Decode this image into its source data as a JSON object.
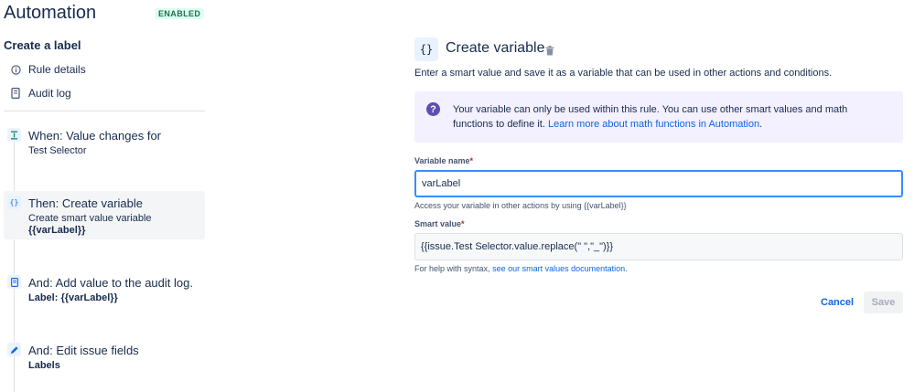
{
  "header": {
    "title": "Automation",
    "badge": "ENABLED"
  },
  "rule": {
    "name": "Create a label"
  },
  "menu": [
    {
      "label": "Rule details",
      "icon": "info-icon"
    },
    {
      "label": "Audit log",
      "icon": "document-icon"
    }
  ],
  "components": [
    {
      "title": "When: Value changes for",
      "sub": "Test Selector",
      "icon": "trigger-icon"
    },
    {
      "title": "Then: Create variable",
      "sub": "Create smart value variable",
      "sub_bold": "{{varLabel}}",
      "icon": "curly-braces-icon"
    },
    {
      "title": "And: Add value to the audit log.",
      "sub_bold": "Label: {{varLabel}}",
      "icon": "document-icon"
    },
    {
      "title": "And: Edit issue fields",
      "sub_bold": "Labels",
      "icon": "pencil-icon"
    }
  ],
  "panel": {
    "icon_glyph": "{}",
    "title": "Create variable",
    "description": "Enter a smart value and save it as a variable that can be used in other actions and conditions.",
    "info_text": "Your variable can only be used within this rule. You can use other smart values and math functions to define it.",
    "info_link": "Learn more about math functions in Automation",
    "info_after": ".",
    "var_name_label": "Variable name",
    "required_mark": "*",
    "var_name_value": "varLabel",
    "var_name_help": "Access your variable in other actions by using {{varLabel}}",
    "smart_value_label": "Smart value",
    "smart_value_value": "{{issue.Test Selector.value.replace(\" \",\"_\")}}",
    "smart_help_prefix": "For help with syntax,",
    "smart_help_link": "see our smart values documentation",
    "smart_help_suffix": ".",
    "cancel_label": "Cancel",
    "save_label": "Save"
  },
  "colors": {
    "accent": "#0c66e4",
    "info_bg": "#f3f0ff",
    "info_icon": "#5e4db2",
    "badge_bg": "#dcfff1",
    "badge_text": "#216e4e"
  }
}
